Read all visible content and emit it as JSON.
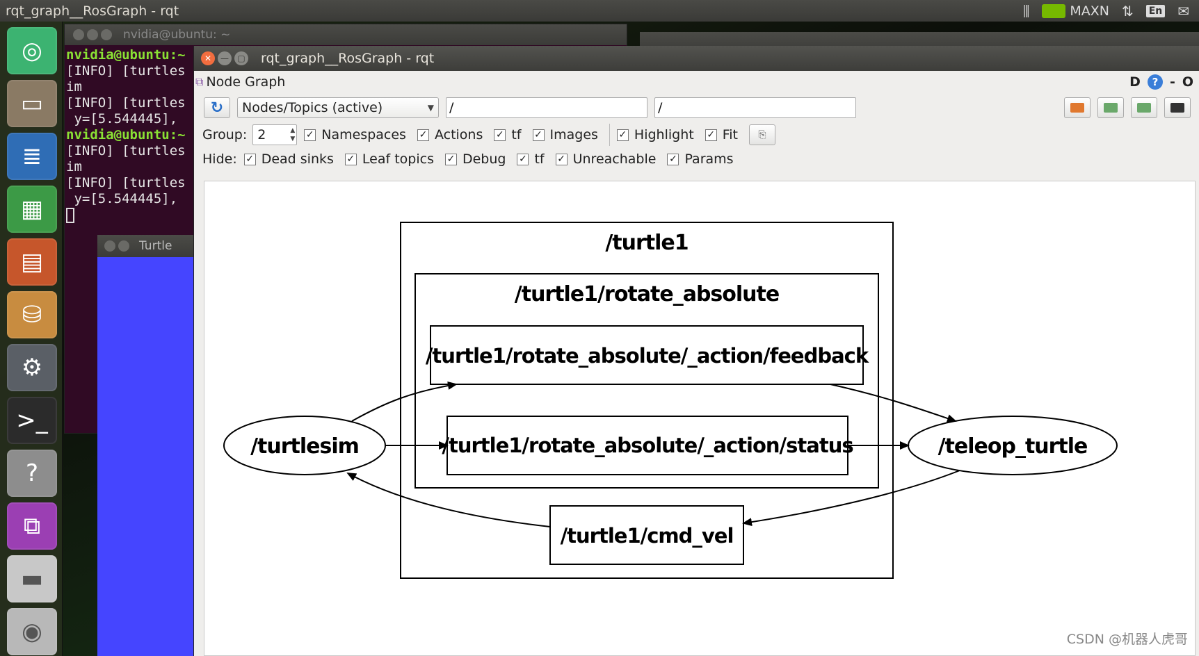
{
  "topbar": {
    "title": "rqt_graph__RosGraph - rqt",
    "power_mode": "MAXN",
    "keyboard": "En"
  },
  "terminal": {
    "title": "nvidia@ubuntu: ~",
    "lines": [
      {
        "prompt": "nvidia@ubuntu:~",
        "text": ""
      },
      {
        "prompt": "",
        "text": "[INFO] [turtles"
      },
      {
        "prompt": "",
        "text": "im"
      },
      {
        "prompt": "",
        "text": "[INFO] [turtles"
      },
      {
        "prompt": "",
        "text": " y=[5.544445],"
      },
      {
        "prompt": "nvidia@ubuntu:~",
        "text": ""
      },
      {
        "prompt": "",
        "text": "[INFO] [turtles"
      },
      {
        "prompt": "",
        "text": "im"
      },
      {
        "prompt": "",
        "text": "[INFO] [turtles"
      },
      {
        "prompt": "",
        "text": " y=[5.544445],"
      }
    ]
  },
  "turtle_window": {
    "title": "Turtle"
  },
  "rqt": {
    "title": "rqt_graph__RosGraph - rqt",
    "plugin_title": "Node Graph",
    "plugin_right": "D",
    "plugin_help": "?",
    "plugin_dash": "-",
    "plugin_o": "O",
    "mode": "Nodes/Topics (active)",
    "node_filter": "/",
    "topic_filter": "/",
    "group_label": "Group:",
    "group_value": "2",
    "options": [
      {
        "label": "Namespaces",
        "checked": true
      },
      {
        "label": "Actions",
        "checked": true
      },
      {
        "label": "tf",
        "checked": true
      },
      {
        "label": "Images",
        "checked": true
      }
    ],
    "view_options": [
      {
        "label": "Highlight",
        "checked": true
      },
      {
        "label": "Fit",
        "checked": true
      }
    ],
    "hide_label": "Hide:",
    "hide": [
      {
        "label": "Dead sinks",
        "checked": true
      },
      {
        "label": "Leaf topics",
        "checked": true
      },
      {
        "label": "Debug",
        "checked": true
      },
      {
        "label": "tf",
        "checked": true
      },
      {
        "label": "Unreachable",
        "checked": true
      },
      {
        "label": "Params",
        "checked": true
      }
    ]
  },
  "graph": {
    "cluster_outer": "/turtle1",
    "cluster_inner": "/turtle1/rotate_absolute",
    "topic_feedback": "/turtle1/rotate_absolute/_action/feedback",
    "topic_status": "/turtle1/rotate_absolute/_action/status",
    "topic_cmd_vel": "/turtle1/cmd_vel",
    "node_turtlesim": "/turtlesim",
    "node_teleop": "/teleop_turtle"
  },
  "watermark": "CSDN @机器人虎哥",
  "colors": {
    "terminal_bg": "#300a24",
    "prompt_green": "#8ae234",
    "turtle_bg": "#4545ff",
    "close_orange": "#f26d3f",
    "nvidia_green": "#76b900"
  }
}
